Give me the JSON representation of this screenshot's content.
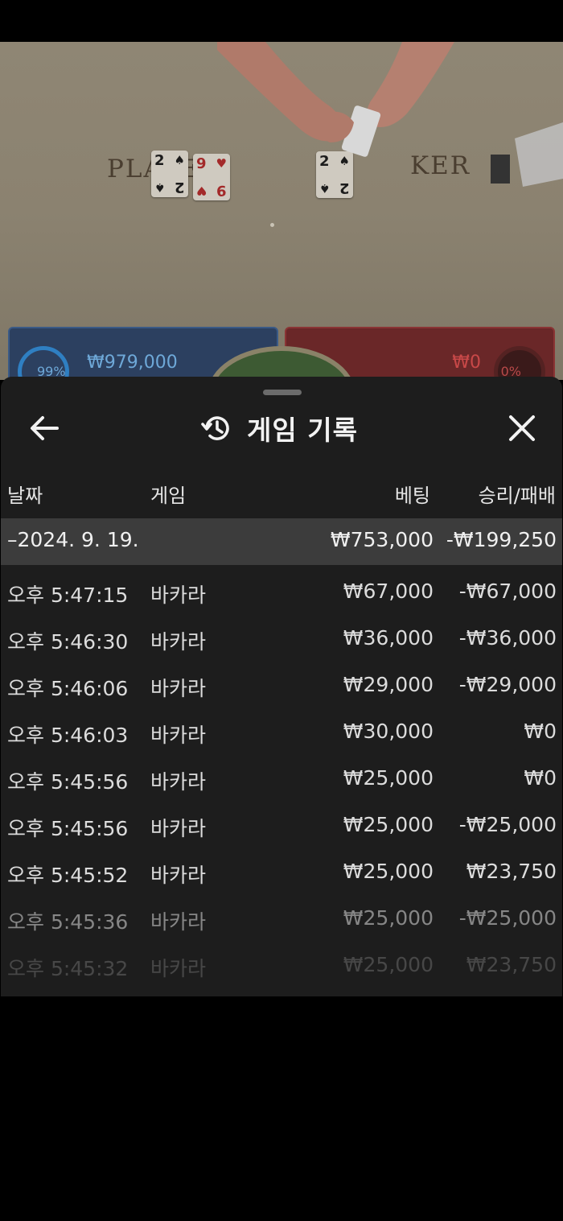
{
  "game_view": {
    "player_label": "PLAYER",
    "banker_label": "KER",
    "player_cards": [
      {
        "rank": "2",
        "suit": "♠",
        "color": "black"
      },
      {
        "rank": "9",
        "suit": "♥",
        "color": "red"
      }
    ],
    "banker_cards": [
      {
        "rank": "2",
        "suit": "♠",
        "color": "black"
      }
    ],
    "player_bet": {
      "percent": "99%",
      "amount": "₩979,000"
    },
    "banker_bet": {
      "percent": "0%",
      "amount": "₩0"
    }
  },
  "sheet": {
    "title": "게임 기록",
    "back_icon": "arrow-left-icon",
    "history_icon": "history-icon",
    "close_icon": "close-icon",
    "columns": {
      "date": "날짜",
      "game": "게임",
      "bet": "베팅",
      "result": "승리/패배"
    },
    "date_group": {
      "label": "–2024. 9. 19.",
      "bet": "₩753,000",
      "result": "-₩199,250"
    },
    "rows": [
      {
        "time": "오후 5:47:15",
        "game": "바카라",
        "bet": "₩67,000",
        "result": "-₩67,000"
      },
      {
        "time": "오후 5:46:30",
        "game": "바카라",
        "bet": "₩36,000",
        "result": "-₩36,000"
      },
      {
        "time": "오후 5:46:06",
        "game": "바카라",
        "bet": "₩29,000",
        "result": "-₩29,000"
      },
      {
        "time": "오후 5:46:03",
        "game": "바카라",
        "bet": "₩30,000",
        "result": "₩0"
      },
      {
        "time": "오후 5:45:56",
        "game": "바카라",
        "bet": "₩25,000",
        "result": "₩0"
      },
      {
        "time": "오후 5:45:56",
        "game": "바카라",
        "bet": "₩25,000",
        "result": "-₩25,000"
      },
      {
        "time": "오후 5:45:52",
        "game": "바카라",
        "bet": "₩25,000",
        "result": "₩23,750"
      },
      {
        "time": "오후 5:45:36",
        "game": "바카라",
        "bet": "₩25,000",
        "result": "-₩25,000"
      },
      {
        "time": "오후 5:45:32",
        "game": "바카라",
        "bet": "₩25,000",
        "result": "₩23,750"
      }
    ]
  }
}
